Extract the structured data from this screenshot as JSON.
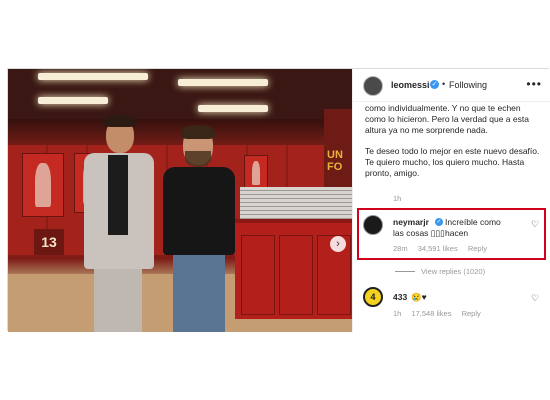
{
  "post": {
    "header": {
      "username": "leomessi",
      "separator": "•",
      "follow_label": "Following",
      "more": "•••"
    },
    "caption_lines": [
      "como individualmente. Y no que te echen como lo hicieron. Pero la verdad que a esta altura ya no me sorprende nada.",
      "Te deseo todo lo mejor en este nuevo desafío. Te quiero mucho, los quiero mucho. Hasta pronto, amigo."
    ],
    "caption_time": "1h",
    "photo": {
      "wall_text": "UN FO",
      "locker_number": "13",
      "next_arrow": "›"
    }
  },
  "comments": [
    {
      "username": "neymarjr",
      "text_line1": "Increíble como hacen",
      "text_line2": "las cosas ▯▯▯",
      "time": "28m",
      "likes": "34,591 likes",
      "reply_label": "Reply",
      "heart": "♡",
      "view_replies": "View replies (1020)",
      "highlighted": true,
      "highlight_color": "#d0021b"
    },
    {
      "username": "433",
      "avatar_text": "4",
      "text": "😢♥",
      "time": "1h",
      "likes": "17,548 likes",
      "reply_label": "Reply",
      "heart": "♡"
    }
  ],
  "colors": {
    "verified": "#3897f0",
    "text": "#262626",
    "muted": "#999999"
  }
}
